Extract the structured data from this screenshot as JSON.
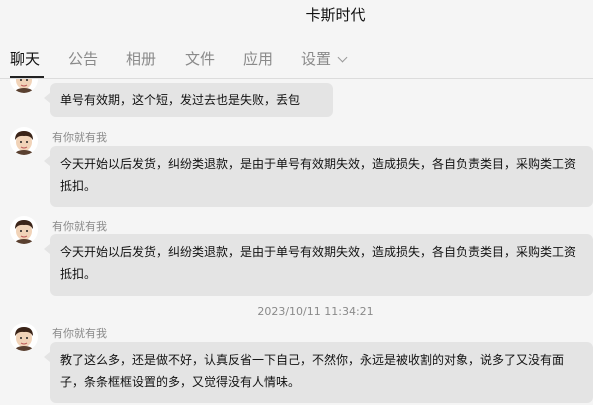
{
  "window": {
    "title": "卡斯时代"
  },
  "tabs": [
    {
      "label": "聊天",
      "active": true
    },
    {
      "label": "公告",
      "active": false
    },
    {
      "label": "相册",
      "active": false
    },
    {
      "label": "文件",
      "active": false
    },
    {
      "label": "应用",
      "active": false
    },
    {
      "label": "设置",
      "active": false
    }
  ],
  "messages": [
    {
      "text": "单号有效期，这个短，发过去也是失败，丢包"
    },
    {
      "sender": "有你就有我",
      "text": "今天开始以后发货，纠纷类退款，是由于单号有效期失效，造成损失，各自负责类目，采购类工资抵扣。"
    },
    {
      "sender": "有你就有我",
      "text": "今天开始以后发货，纠纷类退款，是由于单号有效期失效，造成损失，各自负责类目，采购类工资抵扣。"
    },
    {
      "timestamp": "2023/10/11 11:34:21"
    },
    {
      "sender": "有你就有我",
      "text": "教了这么多，还是做不好，认真反省一下自己，不然你，永远是被收割的对象，说多了又没有面子，条条框框设置的多，又觉得没有人情味。"
    }
  ],
  "colors": {
    "background": "#f5f5f5",
    "bubble": "#e4e4e4",
    "muted_text": "#8a8a8a",
    "active_underline": "#222222"
  }
}
